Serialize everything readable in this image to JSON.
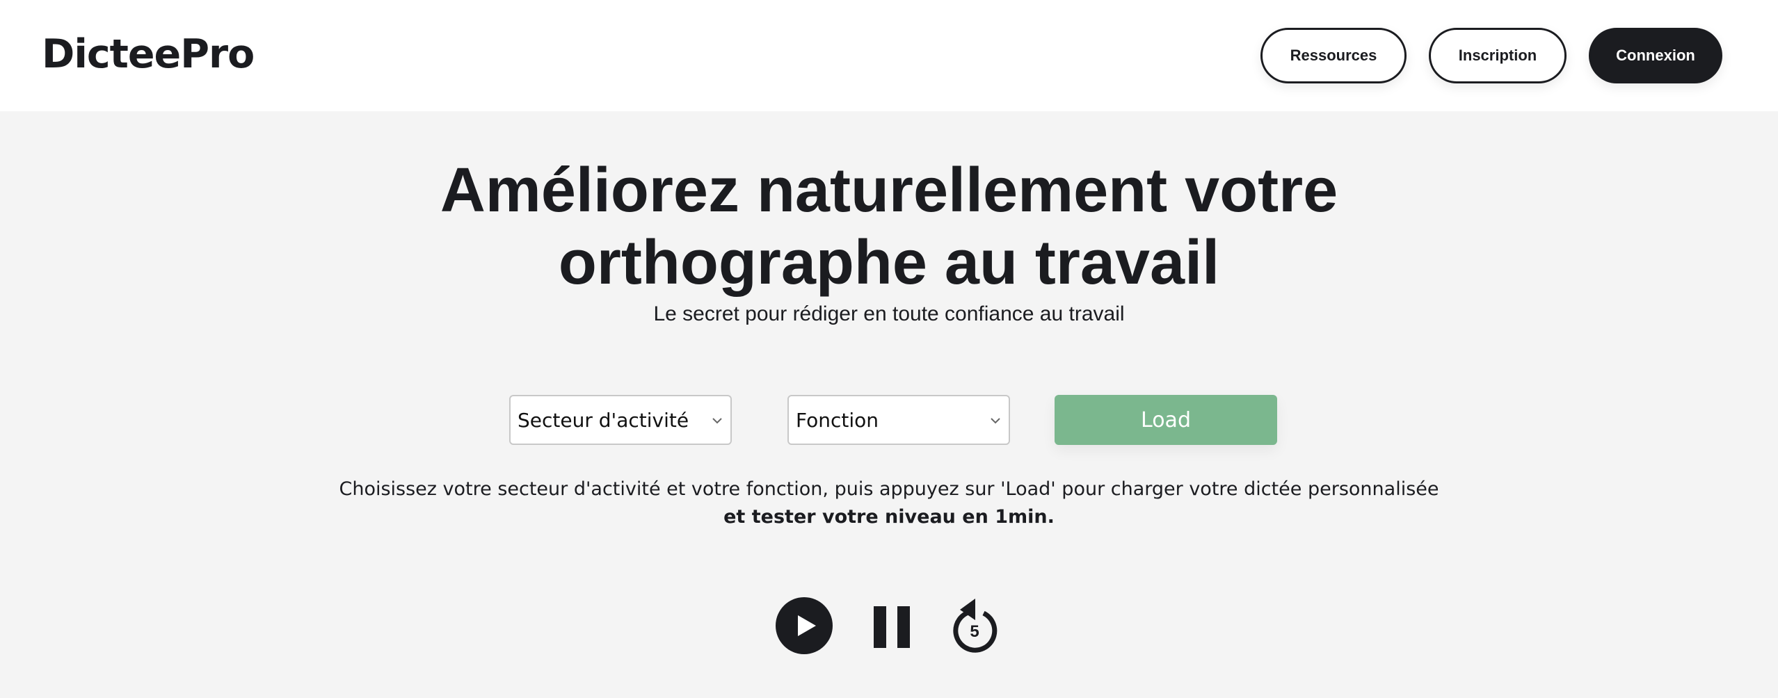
{
  "header": {
    "logo": "DicteePro",
    "nav": {
      "resources_label": "Ressources",
      "signup_label": "Inscription",
      "login_label": "Connexion"
    }
  },
  "hero": {
    "title_line1": "Améliorez naturellement votre",
    "title_line2": "orthographe au travail",
    "subtitle": "Le secret pour rédiger en toute confiance au travail"
  },
  "form": {
    "sector_select": "Secteur d'activité",
    "function_select": "Fonction",
    "load_label": "Load",
    "load_color": "#7bb78e"
  },
  "instructions": {
    "line1": "Choisissez votre secteur d'activité et votre fonction, puis appuyez sur 'Load' pour charger votre dictée personnalisée",
    "line2": "et tester votre niveau en 1min."
  },
  "player": {
    "play_icon": "play-icon",
    "pause_icon": "pause-icon",
    "replay_icon": "replay-5-icon",
    "replay_seconds": "5"
  },
  "colors": {
    "ink": "#1b1c20",
    "background": "#f4f4f4",
    "header_background": "#ffffff"
  }
}
